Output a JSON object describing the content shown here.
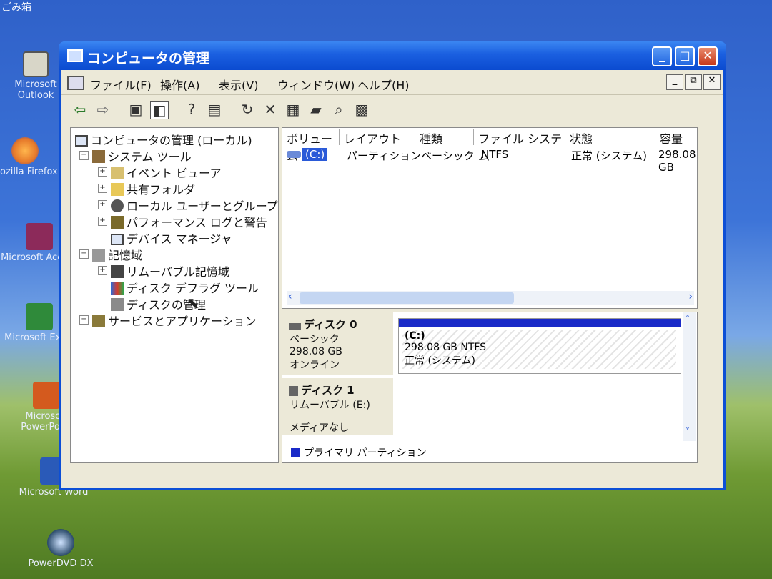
{
  "desktop": {
    "top_label": "ごみ箱",
    "icons": [
      {
        "label": "Microsoft Outlook",
        "color": "#d8d6c8"
      },
      {
        "label": "ozilla Firefox",
        "color": "#e6792a"
      },
      {
        "label": "Microsoft Access",
        "color": "#8c2a5a"
      },
      {
        "label": "Microsoft Excel",
        "color": "#2f8a3a"
      },
      {
        "label": "Microsoft PowerPoint",
        "color": "#d45a1e"
      },
      {
        "label": "Microsoft Word",
        "color": "#2a5ab8"
      },
      {
        "label": "PowerDVD DX",
        "color": "#2a4a6a"
      }
    ]
  },
  "window": {
    "title": "コンピュータの管理",
    "menu": [
      "ファイル(F)",
      "操作(A)",
      "表示(V)",
      "ウィンドウ(W)",
      "ヘルプ(H)"
    ]
  },
  "tree": [
    {
      "label": "コンピュータの管理 (ローカル)",
      "level": 0,
      "pm": ""
    },
    {
      "label": "システム ツール",
      "level": 1,
      "pm": "⊟"
    },
    {
      "label": "イベント ビューア",
      "level": 2,
      "pm": "⊞"
    },
    {
      "label": "共有フォルダ",
      "level": 2,
      "pm": "⊞"
    },
    {
      "label": "ローカル ユーザーとグループ",
      "level": 2,
      "pm": "⊞"
    },
    {
      "label": "パフォーマンス ログと警告",
      "level": 2,
      "pm": "⊞"
    },
    {
      "label": "デバイス マネージャ",
      "level": 2,
      "pm": ""
    },
    {
      "label": "記憶域",
      "level": 1,
      "pm": "⊟"
    },
    {
      "label": "リムーバブル記憶域",
      "level": 2,
      "pm": "⊞"
    },
    {
      "label": "ディスク デフラグ ツール",
      "level": 2,
      "pm": ""
    },
    {
      "label": "ディスクの管理",
      "level": 2,
      "pm": ""
    },
    {
      "label": "サービスとアプリケーション",
      "level": 1,
      "pm": "⊞"
    }
  ],
  "list": {
    "columns": [
      "ボリューム",
      "レイアウト",
      "種類",
      "ファイル システム",
      "状態",
      "容量"
    ],
    "row": [
      "(C:)",
      "パーティション",
      "ベーシック",
      "NTFS",
      "正常 (システム)",
      "298.08 GB"
    ]
  },
  "disks": {
    "disk0": {
      "name": "ディスク 0",
      "type": "ベーシック",
      "size": "298.08 GB",
      "status": "オンライン",
      "vol": "(C:)",
      "vol_size": "298.08 GB NTFS",
      "vol_status": "正常 (システム)"
    },
    "disk1": {
      "name": "ディスク 1",
      "type": "リムーバブル (E:)",
      "status": "メディアなし"
    },
    "legend": "プライマリ パーティション"
  }
}
